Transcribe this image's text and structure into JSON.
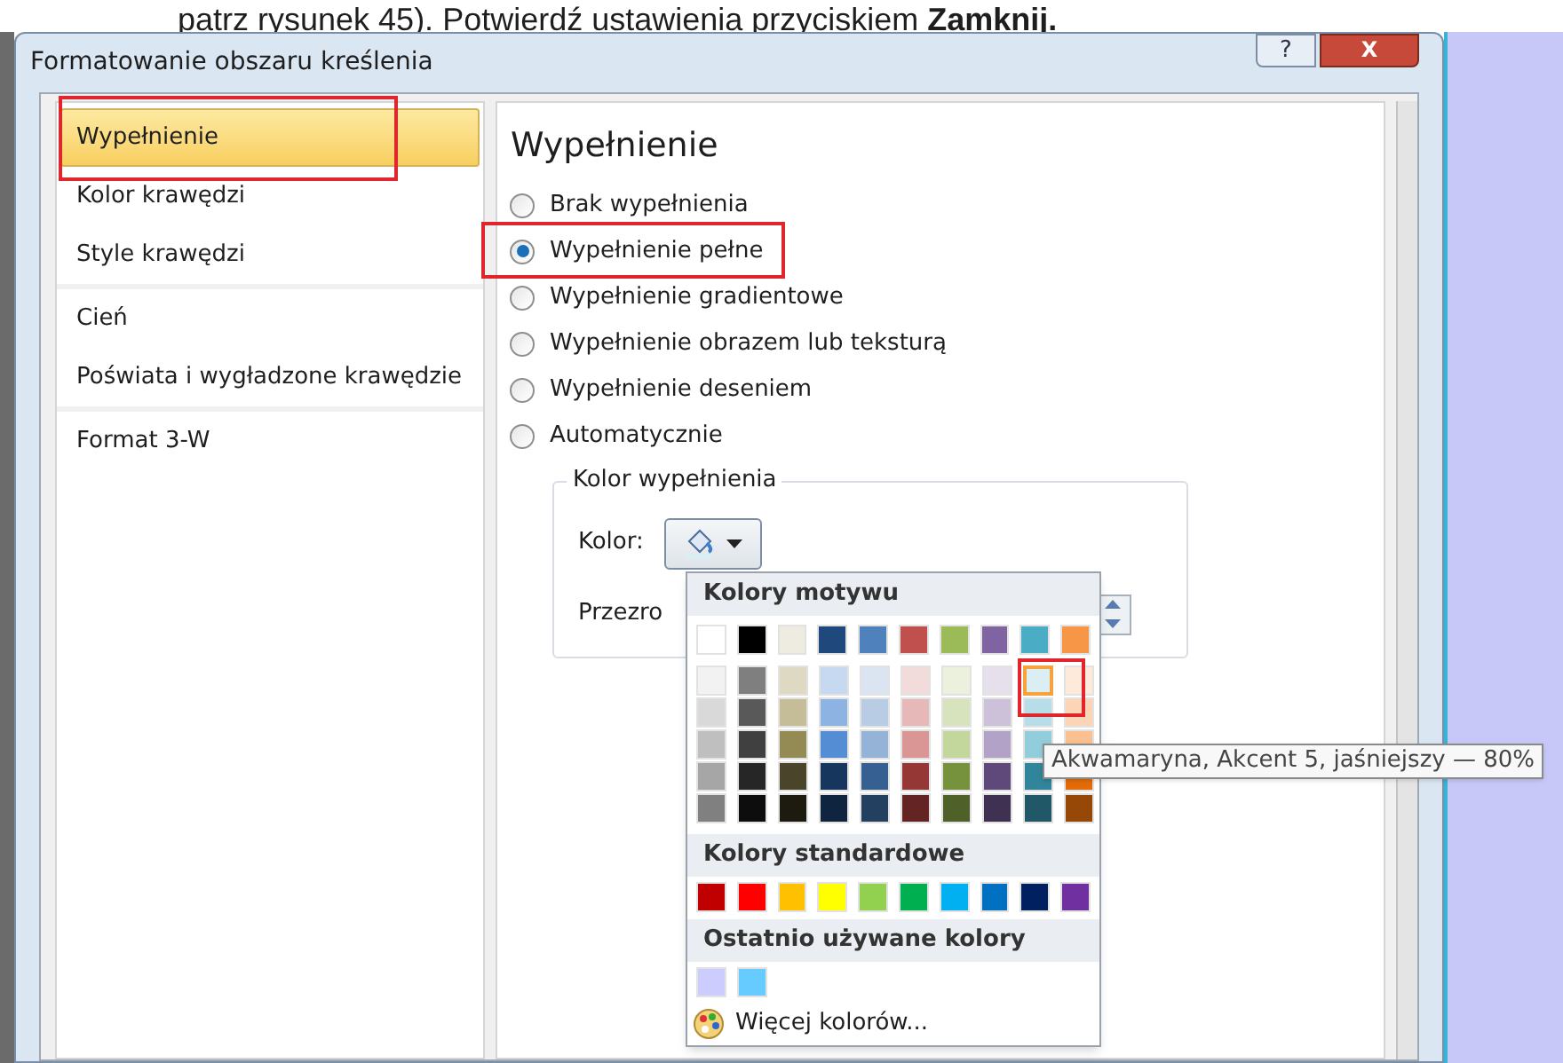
{
  "caption": "patrz rysunek 45). Potwierdź ustawienia przyciskiem **Zamknij.**",
  "window": {
    "title": "Formatowanie obszaru kreślenia",
    "help": "?",
    "close": "X"
  },
  "sidebar": {
    "groups": [
      [
        {
          "label": "Wypełnienie",
          "selected": true
        },
        {
          "label": "Kolor krawędzi",
          "selected": false
        },
        {
          "label": "Style krawędzi",
          "selected": false
        }
      ],
      [
        {
          "label": "Cień",
          "selected": false
        },
        {
          "label": "Poświata i wygładzone krawędzie",
          "selected": false
        }
      ],
      [
        {
          "label": "Format 3-W",
          "selected": false
        }
      ]
    ]
  },
  "panel": {
    "heading": "Wypełnienie",
    "options": [
      {
        "label": "Brak wypełnienia",
        "selected": false
      },
      {
        "label": "Wypełnienie pełne",
        "selected": true
      },
      {
        "label": "Wypełnienie gradientowe",
        "selected": false
      },
      {
        "label": "Wypełnienie obrazem lub teksturą",
        "selected": false
      },
      {
        "label": "Wypełnienie deseniem",
        "selected": false
      },
      {
        "label": "Automatycznie",
        "selected": false
      }
    ],
    "group": {
      "title": "Kolor wypełnienia",
      "color_label": "Kolor:",
      "transparency_label": "Przezro"
    }
  },
  "color_menu": {
    "theme_title": "Kolory motywu",
    "theme": [
      {
        "color": "#ffffff"
      },
      {
        "color": "#000000"
      },
      {
        "color": "#eeece1"
      },
      {
        "color": "#1f497d"
      },
      {
        "color": "#4f81bd"
      },
      {
        "color": "#c0504d"
      },
      {
        "color": "#9bbb59"
      },
      {
        "color": "#8064a2"
      },
      {
        "color": "#4bacc6"
      },
      {
        "color": "#f79646"
      }
    ],
    "shades": [
      [
        {
          "color": "#f2f2f2",
          "selected": false
        },
        {
          "color": "#7f7f7f",
          "selected": false
        },
        {
          "color": "#ddd9c3",
          "selected": false
        },
        {
          "color": "#c6d9f1",
          "selected": false
        },
        {
          "color": "#dbe5f1",
          "selected": false
        },
        {
          "color": "#f2dcdb",
          "selected": false
        },
        {
          "color": "#ebf1dd",
          "selected": false
        },
        {
          "color": "#e5e0ec",
          "selected": false
        },
        {
          "color": "#dbeef3",
          "selected": true
        },
        {
          "color": "#fdeada",
          "selected": false
        }
      ],
      [
        {
          "color": "#d9d9d9",
          "selected": false
        },
        {
          "color": "#595959",
          "selected": false
        },
        {
          "color": "#c4bd97",
          "selected": false
        },
        {
          "color": "#8db3e2",
          "selected": false
        },
        {
          "color": "#b8cce4",
          "selected": false
        },
        {
          "color": "#e6b9b8",
          "selected": false
        },
        {
          "color": "#d7e3bc",
          "selected": false
        },
        {
          "color": "#ccc1d9",
          "selected": false
        },
        {
          "color": "#b7dde8",
          "selected": false
        },
        {
          "color": "#fbd5b5",
          "selected": false
        }
      ],
      [
        {
          "color": "#bfbfbf",
          "selected": false
        },
        {
          "color": "#404040",
          "selected": false
        },
        {
          "color": "#948a54",
          "selected": false
        },
        {
          "color": "#548dd4",
          "selected": false
        },
        {
          "color": "#95b3d7",
          "selected": false
        },
        {
          "color": "#d99694",
          "selected": false
        },
        {
          "color": "#c3d69b",
          "selected": false
        },
        {
          "color": "#b2a2c7",
          "selected": false
        },
        {
          "color": "#92cddc",
          "selected": false
        },
        {
          "color": "#fac08f",
          "selected": false
        }
      ],
      [
        {
          "color": "#a6a6a6",
          "selected": false
        },
        {
          "color": "#262626",
          "selected": false
        },
        {
          "color": "#4a452a",
          "selected": false
        },
        {
          "color": "#17365d",
          "selected": false
        },
        {
          "color": "#366092",
          "selected": false
        },
        {
          "color": "#953734",
          "selected": false
        },
        {
          "color": "#76923c",
          "selected": false
        },
        {
          "color": "#5f497a",
          "selected": false
        },
        {
          "color": "#31859b",
          "selected": false
        },
        {
          "color": "#e36c09",
          "selected": false
        }
      ],
      [
        {
          "color": "#808080",
          "selected": false
        },
        {
          "color": "#0d0d0d",
          "selected": false
        },
        {
          "color": "#1d1b10",
          "selected": false
        },
        {
          "color": "#0f243e",
          "selected": false
        },
        {
          "color": "#244061",
          "selected": false
        },
        {
          "color": "#632423",
          "selected": false
        },
        {
          "color": "#4f6128",
          "selected": false
        },
        {
          "color": "#3f3151",
          "selected": false
        },
        {
          "color": "#205867",
          "selected": false
        },
        {
          "color": "#974806",
          "selected": false
        }
      ]
    ],
    "standard_title": "Kolory standardowe",
    "standard": [
      {
        "color": "#c00000"
      },
      {
        "color": "#ff0000"
      },
      {
        "color": "#ffc000"
      },
      {
        "color": "#ffff00"
      },
      {
        "color": "#92d050"
      },
      {
        "color": "#00b050"
      },
      {
        "color": "#00b0f0"
      },
      {
        "color": "#0070c0"
      },
      {
        "color": "#002060"
      },
      {
        "color": "#7030a0"
      }
    ],
    "recent_title": "Ostatnio używane kolory",
    "recent": [
      {
        "color": "#ccccff"
      },
      {
        "color": "#66ccff"
      }
    ],
    "more": "Więcej kolorów..."
  },
  "tooltip": "Akwamaryna, Akcent 5, jaśniejszy — 80%"
}
